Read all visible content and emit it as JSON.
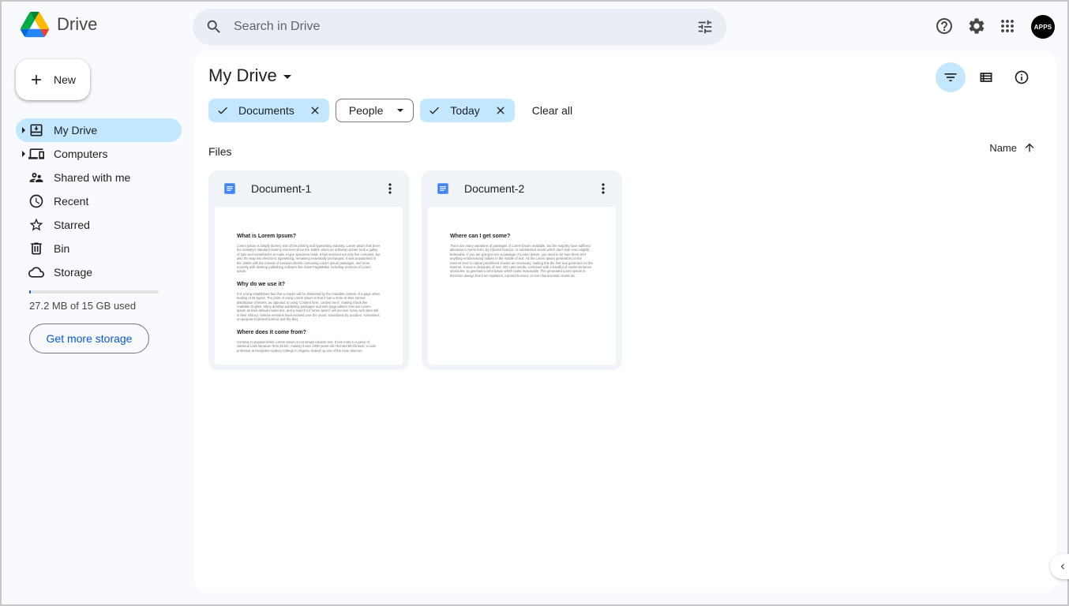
{
  "app": {
    "name": "Drive"
  },
  "search": {
    "placeholder": "Search in Drive"
  },
  "header": {
    "avatar_text": "APPS"
  },
  "sidebar": {
    "new_label": "New",
    "items": [
      {
        "label": "My Drive",
        "icon": "my-drive-icon",
        "active": true
      },
      {
        "label": "Computers",
        "icon": "computers-icon"
      },
      {
        "label": "Shared with me",
        "icon": "shared-icon"
      },
      {
        "label": "Recent",
        "icon": "clock-icon"
      },
      {
        "label": "Starred",
        "icon": "star-icon"
      },
      {
        "label": "Bin",
        "icon": "trash-icon"
      },
      {
        "label": "Storage",
        "icon": "cloud-icon"
      }
    ],
    "storage_used_fraction": 0.0018,
    "storage_text": "27.2 MB of 15 GB used",
    "get_storage_label": "Get more storage"
  },
  "main": {
    "title": "My Drive",
    "chips": [
      {
        "label": "Documents",
        "selected": true
      },
      {
        "label": "People",
        "selected": false
      },
      {
        "label": "Today",
        "selected": true
      }
    ],
    "clear_all": "Clear all",
    "files_label": "Files",
    "sort_label": "Name",
    "files": [
      {
        "name": "Document-1",
        "preview": [
          {
            "heading": "What is Lorem Ipsum?",
            "body": "Lorem Ipsum is simply dummy text of the printing and typesetting industry. Lorem Ipsum has been the industry's standard dummy text ever since the 1500s, when an unknown printer took a galley of type and scrambled it to make a type specimen book. It has survived not only five centuries, but also the leap into electronic typesetting, remaining essentially unchanged. It was popularised in the 1960s with the release of Letraset sheets containing Lorem Ipsum passages, and more recently with desktop publishing software like Aldus PageMaker including versions of Lorem Ipsum."
          },
          {
            "heading": "Why do we use it?",
            "body": "It is a long established fact that a reader will be distracted by the readable content of a page when looking at its layout. The point of using Lorem Ipsum is that it has a more-or-less normal distribution of letters, as opposed to using 'Content here, content here', making it look like readable English. Many desktop publishing packages and web page editors now use Lorem Ipsum as their default model text, and a search for 'lorem ipsum' will uncover many web sites still in their infancy. Various versions have evolved over the years, sometimes by accident, sometimes on purpose (injected humour and the like)."
          },
          {
            "heading": "Where does it come from?",
            "body": "Contrary to popular belief, Lorem Ipsum is not simply random text. It has roots in a piece of classical Latin literature from 45 BC, making it over 2000 years old. Richard McClintock, a Latin professor at Hampden-Sydney College in Virginia, looked up one of the more obscure"
          }
        ]
      },
      {
        "name": "Document-2",
        "preview": [
          {
            "heading": "Where can I get some?",
            "body": "There are many variations of passages of Lorem Ipsum available, but the majority have suffered alteration in some form, by injected humour, or randomised words which don't look even slightly believable. If you are going to use a passage of Lorem Ipsum, you need to be sure there isn't anything embarrassing hidden in the middle of text. All the Lorem Ipsum generators on the Internet tend to repeat predefined chunks as necessary, making this the first true generator on the Internet. It uses a dictionary of over 200 Latin words, combined with a handful of model sentence structures, to generate Lorem Ipsum which looks reasonable. The generated Lorem Ipsum is therefore always free from repetition, injected humour, or non-characteristic words etc."
          }
        ]
      }
    ]
  },
  "colors": {
    "accent": "#0b57d0",
    "active_bg": "#c2e7ff",
    "doc_blue": "#4285f4"
  }
}
